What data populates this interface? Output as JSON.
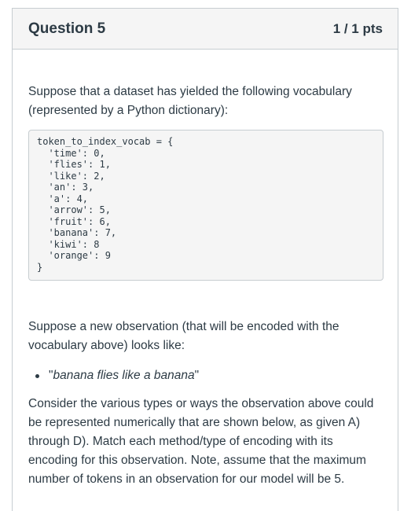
{
  "question": {
    "title": "Question 5",
    "points": "1 / 1 pts"
  },
  "body": {
    "intro": "Suppose that a dataset has yielded the following vocabulary (represented by a Python dictionary):",
    "code_lines": [
      "token_to_index_vocab = {",
      "  'time': 0,",
      "  'flies': 1,",
      "  'like': 2,",
      "  'an': 3,",
      "  'a': 4,",
      "  'arrow': 5,",
      "  'fruit': 6,",
      "  'banana': 7,",
      "  'kiwi': 8",
      "  'orange': 9",
      "}"
    ],
    "observation_intro": "Suppose a new observation (that will be encoded with the vocabulary above) looks like:",
    "observation_open_quote": "\"",
    "observation": "banana flies like a banana",
    "observation_close_quote": "\"",
    "instructions": "Consider the various types or ways the observation above could be represented numerically that are shown below, as given A) through D). Match each method/type of encoding with its encoding for this observation. Note, assume that the maximum number of tokens in an observation for our model will be 5."
  }
}
